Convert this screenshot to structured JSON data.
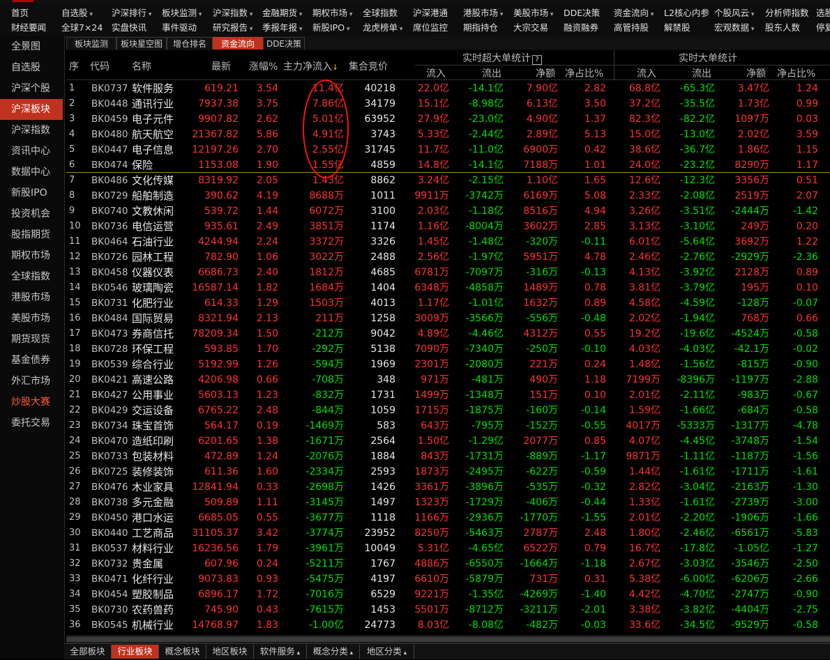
{
  "menu": {
    "row1": [
      {
        "label": "首页",
        "dd": false
      },
      {
        "label": "自选股",
        "dd": true
      },
      {
        "label": "沪深排行",
        "dd": true
      },
      {
        "label": "板块监测",
        "dd": true
      },
      {
        "label": "沪深指数",
        "dd": true
      },
      {
        "label": "金融期货",
        "dd": true
      },
      {
        "label": "期权市场",
        "dd": true
      },
      {
        "label": "全球指数",
        "dd": false
      },
      {
        "label": "沪深港通",
        "dd": false
      },
      {
        "label": "港股市场",
        "dd": true
      },
      {
        "label": "美股市场",
        "dd": true
      },
      {
        "label": "DDE决策",
        "dd": false
      },
      {
        "label": "资金流向",
        "dd": true
      },
      {
        "label": "L2核心内参",
        "dd": false
      },
      {
        "label": "个股风云",
        "dd": true
      },
      {
        "label": "分析师指数",
        "dd": false
      },
      {
        "label": "选股",
        "dd": false
      }
    ],
    "row2": [
      {
        "label": "财经要闻",
        "dd": false
      },
      {
        "label": "全球7×24",
        "dd": false
      },
      {
        "label": "实盘快讯",
        "dd": false
      },
      {
        "label": "事件驱动",
        "dd": false
      },
      {
        "label": "研究报告",
        "dd": true
      },
      {
        "label": "季报年报",
        "dd": true
      },
      {
        "label": "新股IPO",
        "dd": true
      },
      {
        "label": "龙虎榜单",
        "dd": true
      },
      {
        "label": "席位监控",
        "dd": false
      },
      {
        "label": "期指持仓",
        "dd": false
      },
      {
        "label": "大宗交易",
        "dd": false
      },
      {
        "label": "融资融券",
        "dd": false
      },
      {
        "label": "高管持股",
        "dd": false
      },
      {
        "label": "解禁股",
        "dd": false
      },
      {
        "label": "宏观数据",
        "dd": true
      },
      {
        "label": "股东人数",
        "dd": false
      },
      {
        "label": "停复",
        "dd": false
      }
    ]
  },
  "sidebar": [
    {
      "label": "全景图"
    },
    {
      "label": "自选股"
    },
    {
      "label": "沪深个股"
    },
    {
      "label": "沪深板块",
      "active": true
    },
    {
      "label": "沪深指数"
    },
    {
      "label": "资讯中心"
    },
    {
      "label": "数据中心"
    },
    {
      "label": "新股IPO"
    },
    {
      "label": "投资机会"
    },
    {
      "label": "股指期货"
    },
    {
      "label": "期权市场"
    },
    {
      "label": "全球指数"
    },
    {
      "label": "港股市场"
    },
    {
      "label": "美股市场"
    },
    {
      "label": "期货现货"
    },
    {
      "label": "基金债券"
    },
    {
      "label": "外汇市场"
    },
    {
      "label": "炒股大赛",
      "hot": true
    },
    {
      "label": "委托交易"
    }
  ],
  "tabs": [
    {
      "label": "板块监测"
    },
    {
      "label": "板块星空图"
    },
    {
      "label": "增仓排名"
    },
    {
      "label": "资金流向",
      "active": true
    },
    {
      "label": "DDE决策"
    }
  ],
  "headers": {
    "idx": "序",
    "code": "代码",
    "name": "名称",
    "price": "最新",
    "change": "涨幅%",
    "main_flow": "主力净流入",
    "sort_arrow": "↓",
    "auction": "集合竞价",
    "super_group": "实时超大单统计",
    "super_help": "?",
    "big_group": "实时大单统计",
    "inflow": "流入",
    "outflow": "流出",
    "net": "净额",
    "ratio": "净占比%",
    "inflow2": "流入",
    "outflow2": "流出",
    "net2": "净额",
    "ratio2": "净占比%"
  },
  "rows": [
    [
      "1",
      "BK0737",
      "软件服务",
      "619.21",
      "3.54",
      "11.4亿",
      "40218",
      "22.0亿",
      "-14.1亿",
      "7.90亿",
      "2.82",
      "68.8亿",
      "-65.3亿",
      "3.47亿",
      "1.24"
    ],
    [
      "2",
      "BK0448",
      "通讯行业",
      "7937.38",
      "3.75",
      "7.86亿",
      "34179",
      "15.1亿",
      "-8.98亿",
      "6.13亿",
      "3.50",
      "37.2亿",
      "-35.5亿",
      "1.73亿",
      "0.99"
    ],
    [
      "3",
      "BK0459",
      "电子元件",
      "9907.82",
      "2.62",
      "5.01亿",
      "63952",
      "27.9亿",
      "-23.0亿",
      "4.90亿",
      "1.37",
      "82.3亿",
      "-82.2亿",
      "1097万",
      "0.03"
    ],
    [
      "4",
      "BK0480",
      "航天航空",
      "21367.82",
      "5.86",
      "4.91亿",
      "3743",
      "5.33亿",
      "-2.44亿",
      "2.89亿",
      "5.13",
      "15.0亿",
      "-13.0亿",
      "2.02亿",
      "3.59"
    ],
    [
      "5",
      "BK0447",
      "电子信息",
      "12197.26",
      "2.70",
      "2.55亿",
      "31745",
      "11.7亿",
      "-11.0亿",
      "6900万",
      "0.42",
      "38.6亿",
      "-36.7亿",
      "1.86亿",
      "1.15"
    ],
    [
      "6",
      "BK0474",
      "保险",
      "1153.08",
      "1.90",
      "1.55亿",
      "4859",
      "14.8亿",
      "-14.1亿",
      "7188万",
      "1.01",
      "24.0亿",
      "-23.2亿",
      "8290万",
      "1.17"
    ],
    [
      "7",
      "BK0486",
      "文化传媒",
      "8319.92",
      "2.05",
      "1.43亿",
      "8862",
      "3.24亿",
      "-2.15亿",
      "1.10亿",
      "1.65",
      "12.6亿",
      "-12.3亿",
      "3356万",
      "0.51"
    ],
    [
      "8",
      "BK0729",
      "船舶制造",
      "390.62",
      "4.19",
      "8688万",
      "1011",
      "9911万",
      "-3742万",
      "6169万",
      "5.08",
      "2.33亿",
      "-2.08亿",
      "2519万",
      "2.07"
    ],
    [
      "9",
      "BK0740",
      "文教休闲",
      "539.72",
      "1.44",
      "6072万",
      "3100",
      "2.03亿",
      "-1.18亿",
      "8516万",
      "4.94",
      "3.26亿",
      "-3.51亿",
      "-2444万",
      "-1.42"
    ],
    [
      "10",
      "BK0736",
      "电信运营",
      "935.61",
      "2.49",
      "3851万",
      "1174",
      "1.16亿",
      "-8004万",
      "3602万",
      "2.85",
      "3.13亿",
      "-3.10亿",
      "249万",
      "0.20"
    ],
    [
      "11",
      "BK0464",
      "石油行业",
      "4244.94",
      "2.24",
      "3372万",
      "3326",
      "1.45亿",
      "-1.48亿",
      "-320万",
      "-0.11",
      "6.01亿",
      "-5.64亿",
      "3692万",
      "1.22"
    ],
    [
      "12",
      "BK0726",
      "园林工程",
      "782.90",
      "1.06",
      "3022万",
      "2488",
      "2.56亿",
      "-1.97亿",
      "5951万",
      "4.78",
      "2.46亿",
      "-2.76亿",
      "-2929万",
      "-2.36"
    ],
    [
      "13",
      "BK0458",
      "仪器仪表",
      "6686.73",
      "2.40",
      "1812万",
      "4685",
      "6781万",
      "-7097万",
      "-316万",
      "-0.13",
      "4.13亿",
      "-3.92亿",
      "2128万",
      "0.89"
    ],
    [
      "14",
      "BK0546",
      "玻璃陶瓷",
      "16587.14",
      "1.82",
      "1684万",
      "1404",
      "6348万",
      "-4858万",
      "1489万",
      "0.78",
      "3.81亿",
      "-3.79亿",
      "195万",
      "0.10"
    ],
    [
      "15",
      "BK0731",
      "化肥行业",
      "614.33",
      "1.29",
      "1503万",
      "4013",
      "1.17亿",
      "-1.01亿",
      "1632万",
      "0.89",
      "4.58亿",
      "-4.59亿",
      "-128万",
      "-0.07"
    ],
    [
      "16",
      "BK0484",
      "国际贸易",
      "8321.94",
      "2.13",
      "211万",
      "1258",
      "3009万",
      "-3566万",
      "-556万",
      "-0.48",
      "2.02亿",
      "-1.94亿",
      "768万",
      "0.66"
    ],
    [
      "17",
      "BK0473",
      "券商信托",
      "78209.34",
      "1.50",
      "-212万",
      "9042",
      "4.89亿",
      "-4.46亿",
      "4312万",
      "0.55",
      "19.2亿",
      "-19.6亿",
      "-4524万",
      "-0.58"
    ],
    [
      "18",
      "BK0728",
      "环保工程",
      "593.85",
      "1.70",
      "-292万",
      "5138",
      "7090万",
      "-7340万",
      "-250万",
      "-0.10",
      "4.03亿",
      "-4.03亿",
      "-42.1万",
      "-0.02"
    ],
    [
      "19",
      "BK0539",
      "综合行业",
      "5192.99",
      "1.26",
      "-594万",
      "1969",
      "2301万",
      "-2080万",
      "221万",
      "0.24",
      "1.48亿",
      "-1.56亿",
      "-815万",
      "-0.90"
    ],
    [
      "20",
      "BK0421",
      "高速公路",
      "4206.98",
      "0.66",
      "-708万",
      "348",
      "971万",
      "-481万",
      "490万",
      "1.18",
      "7199万",
      "-8396万",
      "-1197万",
      "-2.88"
    ],
    [
      "21",
      "BK0427",
      "公用事业",
      "5603.13",
      "1.23",
      "-832万",
      "1731",
      "1499万",
      "-1348万",
      "151万",
      "0.10",
      "2.01亿",
      "-2.11亿",
      "-983万",
      "-0.67"
    ],
    [
      "22",
      "BK0429",
      "交运设备",
      "6765.22",
      "2.48",
      "-844万",
      "1059",
      "1715万",
      "-1875万",
      "-160万",
      "-0.14",
      "1.59亿",
      "-1.66亿",
      "-684万",
      "-0.58"
    ],
    [
      "23",
      "BK0734",
      "珠宝首饰",
      "564.17",
      "0.19",
      "-1469万",
      "583",
      "643万",
      "-795万",
      "-152万",
      "-0.55",
      "4017万",
      "-5333万",
      "-1317万",
      "-4.78"
    ],
    [
      "24",
      "BK0470",
      "造纸印刷",
      "6201.65",
      "1.38",
      "-1671万",
      "2564",
      "1.50亿",
      "-1.29亿",
      "2077万",
      "0.85",
      "4.07亿",
      "-4.45亿",
      "-3748万",
      "-1.54"
    ],
    [
      "25",
      "BK0733",
      "包装材料",
      "472.89",
      "1.24",
      "-2076万",
      "1884",
      "843万",
      "-1731万",
      "-889万",
      "-1.17",
      "9871万",
      "-1.11亿",
      "-1187万",
      "-1.56"
    ],
    [
      "26",
      "BK0725",
      "装修装饰",
      "611.36",
      "1.60",
      "-2334万",
      "2593",
      "1873万",
      "-2495万",
      "-622万",
      "-0.59",
      "1.44亿",
      "-1.61亿",
      "-1711万",
      "-1.61"
    ],
    [
      "27",
      "BK0476",
      "木业家具",
      "12841.94",
      "0.33",
      "-2698万",
      "1426",
      "3361万",
      "-3896万",
      "-535万",
      "-0.32",
      "2.82亿",
      "-3.04亿",
      "-2163万",
      "-1.30"
    ],
    [
      "28",
      "BK0738",
      "多元金融",
      "509.89",
      "1.11",
      "-3145万",
      "1497",
      "1323万",
      "-1729万",
      "-406万",
      "-0.44",
      "1.33亿",
      "-1.61亿",
      "-2739万",
      "-3.00"
    ],
    [
      "29",
      "BK0450",
      "港口水运",
      "6685.05",
      "0.55",
      "-3677万",
      "1118",
      "1166万",
      "-2936万",
      "-1770万",
      "-1.55",
      "2.01亿",
      "-2.20亿",
      "-1906万",
      "-1.66"
    ],
    [
      "30",
      "BK0440",
      "工艺商品",
      "31105.37",
      "3.42",
      "-3774万",
      "23952",
      "8250万",
      "-5463万",
      "2787万",
      "2.48",
      "1.80亿",
      "-2.46亿",
      "-6561万",
      "-5.83"
    ],
    [
      "31",
      "BK0537",
      "材料行业",
      "16236.56",
      "1.79",
      "-3961万",
      "10049",
      "5.31亿",
      "-4.65亿",
      "6522万",
      "0.79",
      "16.7亿",
      "-17.8亿",
      "-1.05亿",
      "-1.27"
    ],
    [
      "32",
      "BK0732",
      "贵金属",
      "607.96",
      "0.24",
      "-5211万",
      "1767",
      "4886万",
      "-6550万",
      "-1664万",
      "-1.18",
      "2.67亿",
      "-3.03亿",
      "-3546万",
      "-2.50"
    ],
    [
      "33",
      "BK0471",
      "化纤行业",
      "9073.83",
      "0.93",
      "-5475万",
      "4197",
      "6610万",
      "-5879万",
      "731万",
      "0.31",
      "5.38亿",
      "-6.00亿",
      "-6206万",
      "-2.66"
    ],
    [
      "34",
      "BK0454",
      "塑胶制品",
      "6896.17",
      "1.72",
      "-7016万",
      "6529",
      "9221万",
      "-1.35亿",
      "-4269万",
      "-1.40",
      "4.42亿",
      "-4.70亿",
      "-2747万",
      "-0.90"
    ],
    [
      "35",
      "BK0730",
      "农药兽药",
      "745.90",
      "0.43",
      "-7615万",
      "1453",
      "5501万",
      "-8712万",
      "-3211万",
      "-2.01",
      "3.38亿",
      "-3.82亿",
      "-4404万",
      "-2.75"
    ],
    [
      "36",
      "BK0545",
      "机械行业",
      "14768.97",
      "1.83",
      "-1.00亿",
      "24773",
      "8.03亿",
      "-8.08亿",
      "-482万",
      "-0.03",
      "33.6亿",
      "-34.5亿",
      "-9529万",
      "-0.58"
    ]
  ],
  "bottom_tabs": [
    {
      "label": "全部板块"
    },
    {
      "label": "行业板块",
      "active": true
    },
    {
      "label": "概念板块"
    },
    {
      "label": "地区板块"
    },
    {
      "label": "软件服务",
      "dd": true
    },
    {
      "label": "概念分类",
      "dd": true
    },
    {
      "label": "地区分类",
      "dd": true
    }
  ],
  "colors": {
    "up": "#ff3232",
    "down": "#00e000",
    "accent": "#c0321d",
    "highlight": "#ff1010"
  }
}
